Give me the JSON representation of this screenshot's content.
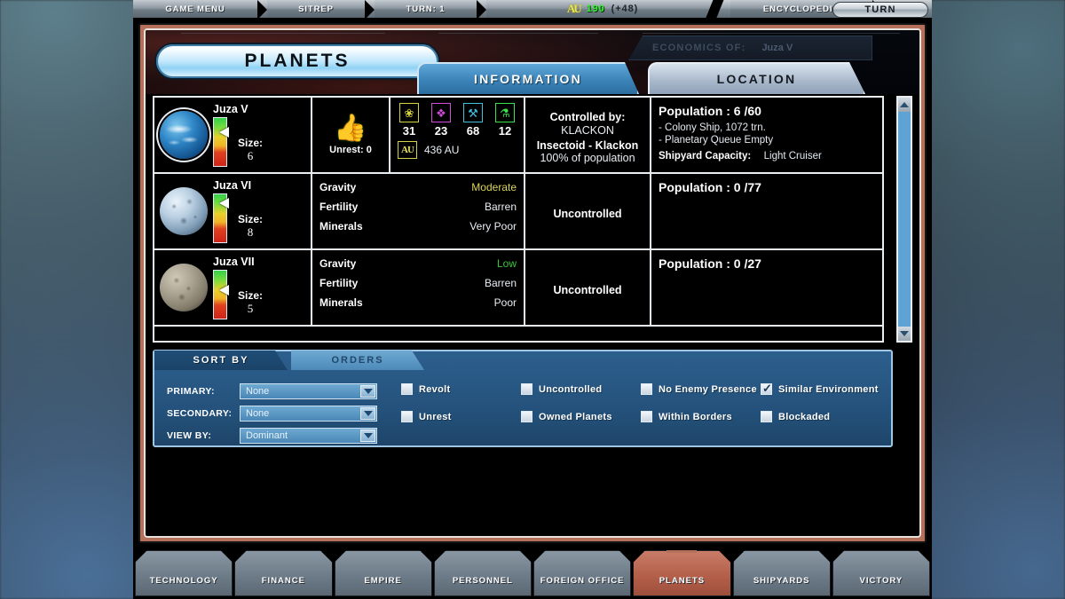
{
  "topbar": {
    "game_menu": "GAME MENU",
    "sitrep": "SITREP",
    "turn": "TURN: 1",
    "credits_icon": "credits-icon",
    "credits_value": "190",
    "credits_delta": "(+48)",
    "encyclopedia": "ENCYCLOPEDIA",
    "turn_button": "TURN"
  },
  "header": {
    "title": "PLANETS",
    "economics_label": "ECONOMICS OF:",
    "economics_value": "Juza V",
    "tab_information": "INFORMATION",
    "tab_location": "LOCATION"
  },
  "planets": [
    {
      "name": "Juza V",
      "size_label": "Size:",
      "size": "6",
      "env_marker_pct": 18,
      "globe_class": "g1",
      "unrest_label": "Unrest: 0",
      "resources": [
        {
          "icon": "food-icon",
          "glyph": "❀",
          "color": "#d8d23c",
          "value": "31"
        },
        {
          "icon": "minerals-icon",
          "glyph": "❖",
          "color": "#d04bd8",
          "value": "23"
        },
        {
          "icon": "industry-icon",
          "glyph": "⚒",
          "color": "#46bedd",
          "value": "68"
        },
        {
          "icon": "research-icon",
          "glyph": "⚗",
          "color": "#3ce04a",
          "value": "12"
        }
      ],
      "au_badge": "AU",
      "au_value": "436 AU",
      "controlled_by_label": "Controlled by:",
      "controlled_by": "KLACKON",
      "race": "Insectoid - Klackon",
      "race_pct": "100% of population",
      "population": "Population : 6 /60",
      "detail_lines": [
        "- Colony Ship, 1072 trn.",
        "- Planetary Queue Empty"
      ],
      "shipyard_label": "Shipyard Capacity:",
      "shipyard_value": "Light Cruiser"
    },
    {
      "name": "Juza VI",
      "size_label": "Size:",
      "size": "8",
      "env_marker_pct": 8,
      "globe_class": "g2",
      "env": [
        {
          "key": "Gravity",
          "value": "Moderate",
          "color": "#d9d45a"
        },
        {
          "key": "Fertility",
          "value": "Barren",
          "color": "#e9eef3"
        },
        {
          "key": "Minerals",
          "value": "Very Poor",
          "color": "#e9eef3"
        }
      ],
      "controlled_by": "Uncontrolled",
      "population": "Population : 0 /77"
    },
    {
      "name": "Juza VII",
      "size_label": "Size:",
      "size": "5",
      "env_marker_pct": 30,
      "globe_class": "g3",
      "env": [
        {
          "key": "Gravity",
          "value": "Low",
          "color": "#3ac43a"
        },
        {
          "key": "Fertility",
          "value": "Barren",
          "color": "#e9eef3"
        },
        {
          "key": "Minerals",
          "value": "Poor",
          "color": "#e9eef3"
        }
      ],
      "controlled_by": "Uncontrolled",
      "population": "Population : 0 /27"
    }
  ],
  "scrollbar": {
    "up": "scroll-up-icon",
    "down": "scroll-down-icon"
  },
  "filters": {
    "tab_sort_by": "SORT BY",
    "tab_orders": "ORDERS",
    "primary_label": "PRIMARY:",
    "primary_value": "None",
    "secondary_label": "SECONDARY:",
    "secondary_value": "None",
    "view_by_label": "VIEW BY:",
    "view_by_value": "Dominant",
    "checkboxes": [
      {
        "label": "Revolt",
        "checked": false
      },
      {
        "label": "Uncontrolled",
        "checked": false
      },
      {
        "label": "No Enemy Presence",
        "checked": false
      },
      {
        "label": "Similar Environment",
        "checked": true
      },
      {
        "label": "Unrest",
        "checked": false
      },
      {
        "label": "Owned Planets",
        "checked": false
      },
      {
        "label": "Within Borders",
        "checked": false
      },
      {
        "label": "Blockaded",
        "checked": false
      }
    ]
  },
  "bottom_nav": [
    {
      "label": "TECHNOLOGY",
      "active": false
    },
    {
      "label": "FINANCE",
      "active": false
    },
    {
      "label": "EMPIRE",
      "active": false
    },
    {
      "label": "PERSONNEL",
      "active": false
    },
    {
      "label": "FOREIGN OFFICE",
      "active": false
    },
    {
      "label": "PLANETS",
      "active": true
    },
    {
      "label": "SHIPYARDS",
      "active": false
    },
    {
      "label": "VICTORY",
      "active": false
    }
  ]
}
